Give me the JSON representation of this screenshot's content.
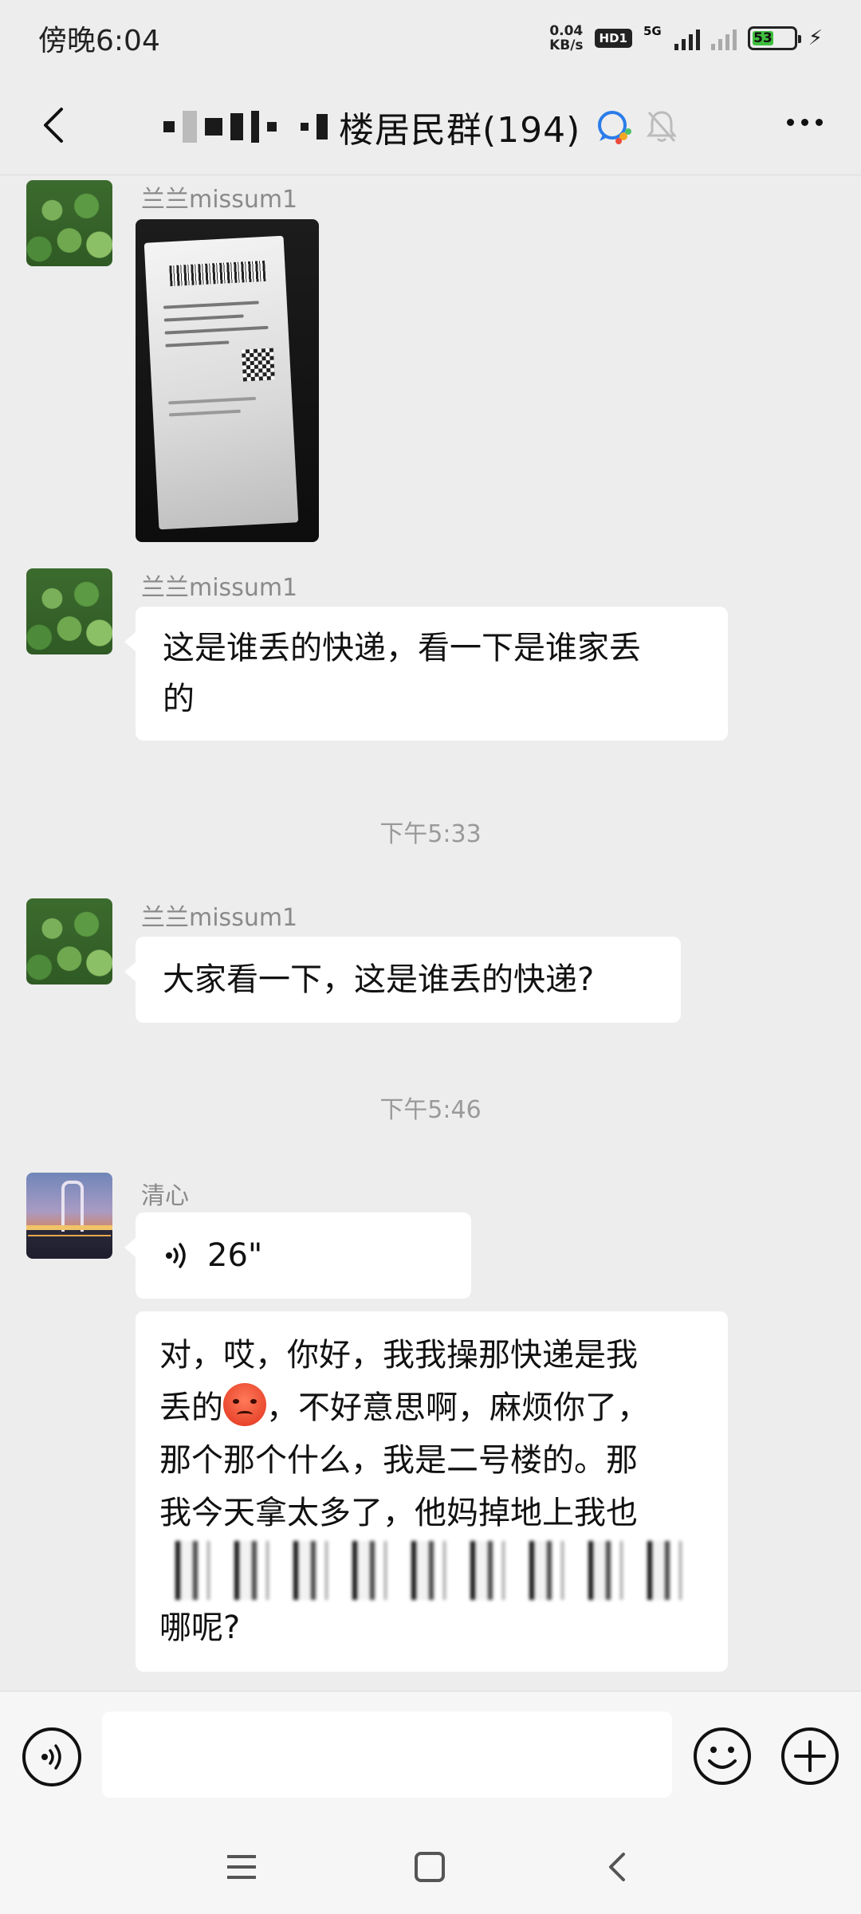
{
  "status_bar": {
    "time": "傍晚6:04",
    "net_speed_value": "0.04",
    "net_speed_unit": "KB/s",
    "hd_badge": "HD1",
    "network_label": "5G",
    "battery_level": "53",
    "battery_color": "#3fbf3f"
  },
  "header": {
    "title": "楼居民群(194)",
    "title_mask_note_icon": "redacted-name",
    "back_icon": "back-arrow-icon",
    "group_type_icon": "wecom-icon",
    "mute_icon": "bell-muted-icon",
    "more_icon": "more-dots-icon"
  },
  "messages": [
    {
      "type": "image",
      "sender": "兰兰missum1",
      "avatar": "lotus-leaves-avatar",
      "content_description": "package-label-photo"
    },
    {
      "type": "text",
      "sender": "兰兰missum1",
      "avatar": "lotus-leaves-avatar",
      "line1": "这是谁丢的快递，看一下是谁家丢",
      "line2": "的"
    },
    {
      "type": "timestamp",
      "text": "下午5:33"
    },
    {
      "type": "text",
      "sender": "兰兰missum1",
      "avatar": "lotus-leaves-avatar",
      "line1": "大家看一下，这是谁丢的快递?"
    },
    {
      "type": "timestamp",
      "text": "下午5:46"
    },
    {
      "type": "voice",
      "sender": "清心",
      "avatar": "bridge-night-avatar",
      "duration": "26\""
    },
    {
      "type": "transcript",
      "line1": "对，哎，你好，我我操那快递是我",
      "line2_pre": "丢的",
      "line2_post": "，不好意思啊，麻烦你了，",
      "line3": "那个那个什么，我是二号楼的。那",
      "line4": "我今天拿太多了，他妈掉地上我也",
      "line6": "哪呢?"
    }
  ],
  "input_bar": {
    "voice_toggle_icon": "voice-input-icon",
    "input_value": "",
    "emoji_icon": "emoji-icon",
    "plus_icon": "plus-icon"
  },
  "system_nav": {
    "menu_icon": "menu-icon",
    "home_icon": "home-icon",
    "back_icon": "back-icon"
  }
}
